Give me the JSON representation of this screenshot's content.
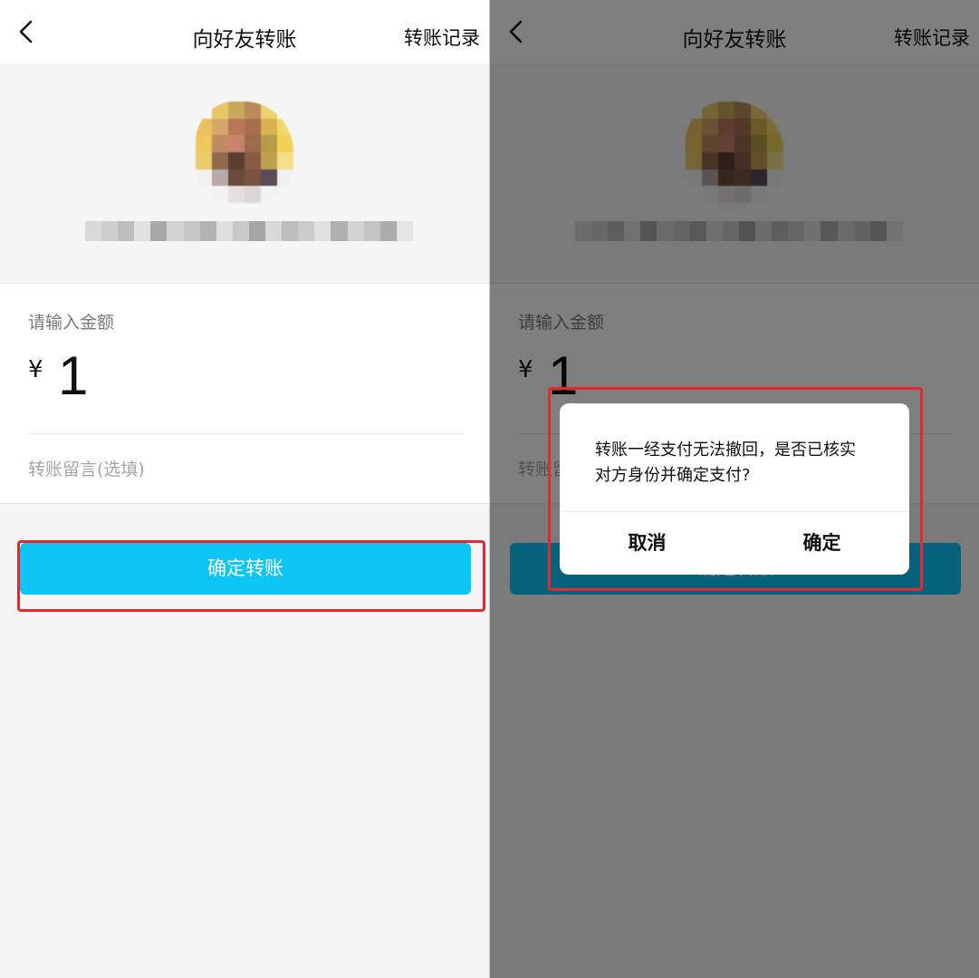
{
  "screens": [
    {
      "nav": {
        "title": "向好友转账",
        "right_link": "转账记录"
      },
      "form": {
        "amount_label": "请输入金额",
        "currency_symbol": "¥",
        "amount_value": "1",
        "memo_placeholder": "转账留言(选填)"
      },
      "confirm_button": "确定转账"
    },
    {
      "nav": {
        "title": "向好友转账",
        "right_link": "转账记录"
      },
      "form": {
        "amount_label": "请输入金额",
        "currency_symbol": "¥",
        "amount_value": "1",
        "memo_placeholder": "转账留言(选填)"
      },
      "confirm_button": "确定转账",
      "dialog": {
        "message_line1": "转账一经支付无法撤回，是否已核实",
        "message_line2": "对方身份并确定支付?",
        "cancel_label": "取消",
        "ok_label": "确定"
      }
    }
  ],
  "colors": {
    "primary_button": "#0cc5f4",
    "highlight_border": "#e5282c",
    "overlay": "rgba(0,0,0,0.5)"
  },
  "icons": {
    "back": "chevron-left-icon"
  }
}
